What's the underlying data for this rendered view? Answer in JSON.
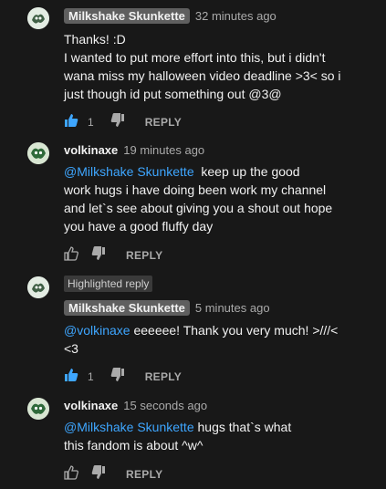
{
  "comments": [
    {
      "author": "Milkshake Skunkette",
      "author_chip": true,
      "time": "32 minutes ago",
      "lines": [
        "Thanks! :D",
        "I wanted to put more effort into this, but i didn't",
        "wana miss my halloween video deadline >3< so i",
        "just though id put something out @3@"
      ],
      "likes": "1",
      "liked": true,
      "reply_label": "REPLY"
    },
    {
      "author": "volkinaxe",
      "author_chip": false,
      "time": "19 minutes ago",
      "mention": "@Milkshake Skunkette",
      "first_line_rest": "  keep up the good",
      "lines": [
        "work hugs i have doing  been work my channel",
        "and let`s see about giving you a shout out  hope",
        "you have a good fluffy day"
      ],
      "likes": "",
      "liked": false,
      "reply_label": "REPLY"
    },
    {
      "highlight": "Highlighted reply",
      "author": "Milkshake Skunkette",
      "author_chip": true,
      "time": "5 minutes ago",
      "mention": "@volkinaxe",
      "first_line_rest": " eeeeee! Thank you very much! >///<",
      "lines": [
        "<3"
      ],
      "likes": "1",
      "liked": true,
      "reply_label": "REPLY"
    },
    {
      "author": "volkinaxe",
      "author_chip": false,
      "time": "15 seconds ago",
      "mention": "@Milkshake Skunkette",
      "first_line_rest": " hugs that`s what",
      "lines": [
        "this fandom is about ^w^"
      ],
      "likes": "",
      "liked": false,
      "reply_label": "REPLY"
    }
  ],
  "colors": {
    "background": "#181818",
    "mention": "#3ea6ff",
    "liked_icon": "#3ea6ff",
    "muted": "#aaaaaa"
  },
  "icons": {
    "like": "thumbs-up-icon",
    "dislike": "thumbs-down-icon"
  }
}
